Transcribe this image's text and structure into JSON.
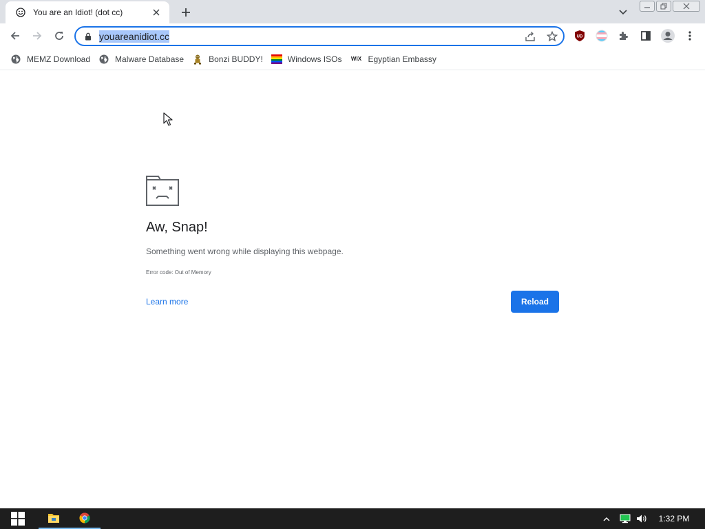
{
  "tab": {
    "title": "You are an Idiot! (dot cc)",
    "favicon": "smiley-icon"
  },
  "toolbar": {
    "url": "youareanidiot.cc"
  },
  "bookmarks": [
    {
      "label": "MEMZ Download",
      "icon": "globe-icon"
    },
    {
      "label": "Malware Database",
      "icon": "globe-icon"
    },
    {
      "label": "Bonzi BUDDY!",
      "icon": "bonzi-icon"
    },
    {
      "label": "Windows ISOs",
      "icon": "rainbow-flag-icon"
    },
    {
      "label": "Egyptian Embassy",
      "icon": "wix-icon",
      "icon_text": "WIX"
    }
  ],
  "error": {
    "title": "Aw, Snap!",
    "message": "Something went wrong while displaying this webpage.",
    "code": "Error code: Out of Memory",
    "learn_more": "Learn more",
    "reload": "Reload"
  },
  "taskbar": {
    "time": "1:32 PM"
  },
  "colors": {
    "accent": "#1a73e8",
    "taskbar": "#1e1e1e",
    "tabstrip": "#dee1e6"
  }
}
